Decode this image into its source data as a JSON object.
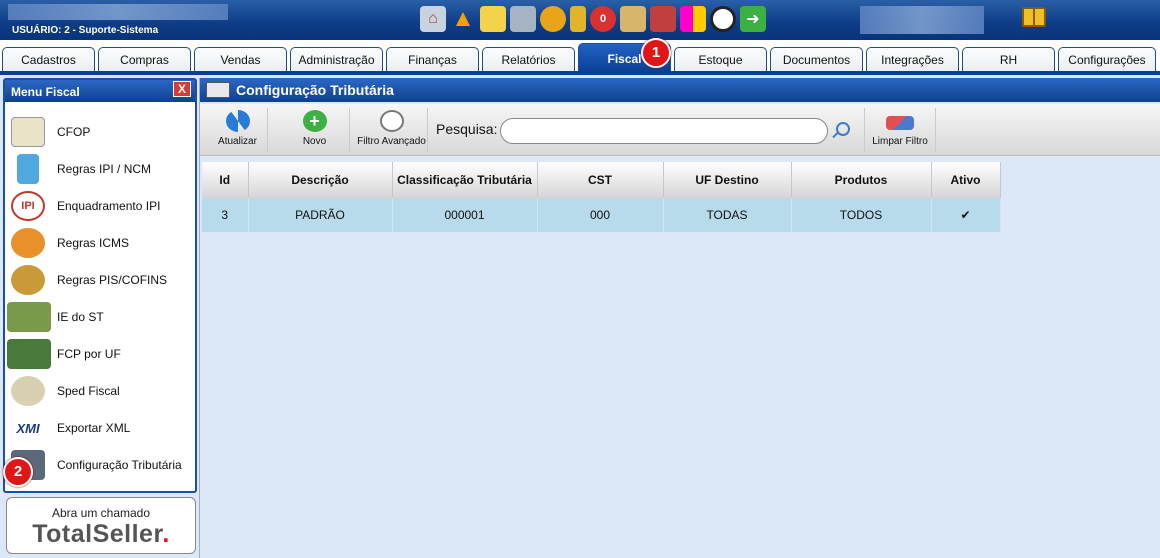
{
  "user": {
    "label": "USUÁRIO:  2 - Suporte-Sistema"
  },
  "top_icons": [
    "home-icon",
    "warning-icon",
    "broom-icon",
    "cart-icon",
    "monitor-icon",
    "phone-icon",
    "alert-badge-icon",
    "users-icon",
    "factory-icon",
    "grid-icon",
    "clock-icon",
    "exit-icon"
  ],
  "tabs": [
    {
      "label": "Cadastros"
    },
    {
      "label": "Compras"
    },
    {
      "label": "Vendas"
    },
    {
      "label": "Administração"
    },
    {
      "label": "Finanças"
    },
    {
      "label": "Relatórios"
    },
    {
      "label": "Fiscal"
    },
    {
      "label": "Estoque"
    },
    {
      "label": "Documentos"
    },
    {
      "label": "Integrações"
    },
    {
      "label": "RH"
    },
    {
      "label": "Configurações"
    }
  ],
  "badges": {
    "one": "1",
    "two": "2"
  },
  "menu": {
    "title": "Menu Fiscal",
    "close": "X",
    "items": [
      {
        "label": "CFOP"
      },
      {
        "label": "Regras IPI / NCM"
      },
      {
        "label": "Enquadramento IPI"
      },
      {
        "label": "Regras ICMS"
      },
      {
        "label": "Regras PIS/COFINS"
      },
      {
        "label": "IE do ST"
      },
      {
        "label": "FCP por UF"
      },
      {
        "label": "Sped Fiscal"
      },
      {
        "label": "Exportar XML"
      },
      {
        "label": "Configuração Tributária"
      }
    ],
    "icon_text": {
      "ipi": "IPI",
      "xml": "XMI"
    }
  },
  "support": {
    "top": "Abra um chamado",
    "brand_main": "TotalSeller",
    "brand_dot": "."
  },
  "main": {
    "title": "Configuração Tributária",
    "toolbar": {
      "refresh": "Atualizar",
      "new": "Novo",
      "advanced_filter": "Filtro Avançado",
      "search_label": "Pesquisa:",
      "search_value": "",
      "clear_filter": "Limpar Filtro"
    },
    "table": {
      "columns": [
        "Id",
        "Descrição",
        "Classificação Tributária",
        "CST",
        "UF Destino",
        "Produtos",
        "Ativo"
      ],
      "rows": [
        [
          "3",
          "PADRÃO",
          "000001",
          "000",
          "TODAS",
          "TODOS",
          "✔"
        ]
      ]
    }
  },
  "colors": {
    "brand_blue": "#0b3f96",
    "badge_red": "#e01616",
    "row_bg": "#b7dbea",
    "check_green": "#2fa84a"
  }
}
